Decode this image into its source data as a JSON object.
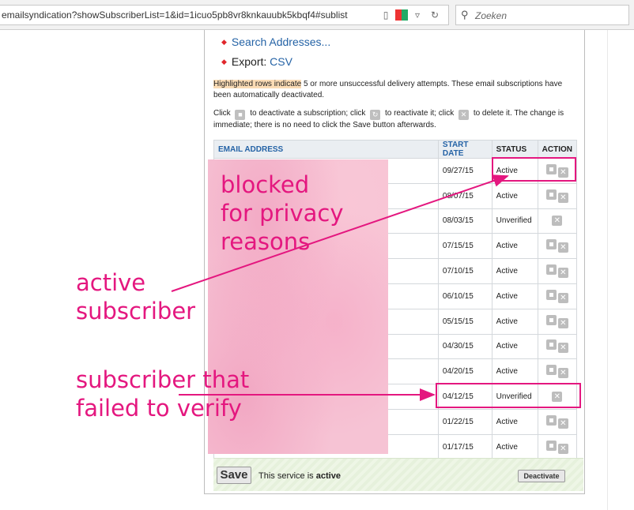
{
  "browser": {
    "url": "emailsyndication?showSubscriberList=1&id=1icuo5pb8vr8knkauubk5kbqf4#sublist",
    "search_placeholder": "Zoeken",
    "search_icon": "magnifier-icon",
    "reader_icon": "reader-icon",
    "refresh_icon": "refresh-icon"
  },
  "links": {
    "search_addresses": "Search Addresses...",
    "export_label": "Export:",
    "export_link": "CSV"
  },
  "notes": {
    "highlighted_prefix": "Highlighted rows indicate",
    "highlighted_rest": " 5 or more unsuccessful delivery attempts. These email subscriptions have been automatically deactivated.",
    "click_1": "Click",
    "click_2": "to deactivate a subscription; click",
    "click_3": "to reactivate it; click",
    "click_4": "to delete it. The change is immediate; there is no need to click the Save button afterwards."
  },
  "table": {
    "headers": {
      "email": "EMAIL ADDRESS",
      "start_date": "START DATE",
      "status": "STATUS",
      "action": "ACTION"
    },
    "rows": [
      {
        "date": "09/27/15",
        "status": "Active"
      },
      {
        "date": "08/07/15",
        "status": "Active"
      },
      {
        "date": "08/03/15",
        "status": "Unverified"
      },
      {
        "date": "07/15/15",
        "status": "Active"
      },
      {
        "date": "07/10/15",
        "status": "Active"
      },
      {
        "date": "06/10/15",
        "status": "Active"
      },
      {
        "date": "05/15/15",
        "status": "Active"
      },
      {
        "date": "04/30/15",
        "status": "Active"
      },
      {
        "date": "04/20/15",
        "status": "Active"
      },
      {
        "date": "04/12/15",
        "status": "Unverified"
      },
      {
        "date": "01/22/15",
        "status": "Active"
      },
      {
        "date": "01/17/15",
        "status": "Active"
      }
    ]
  },
  "footer": {
    "save": "Save",
    "service_prefix": "This service is ",
    "service_state": "active",
    "deactivate": "Deactivate"
  },
  "annotations": {
    "privacy_1": "blocked",
    "privacy_2": "for privacy",
    "privacy_3": "reasons",
    "active_1": "active",
    "active_2": "subscriber",
    "failed_1": "subscriber that",
    "failed_2": "failed to verify",
    "color": "#e4177f"
  }
}
